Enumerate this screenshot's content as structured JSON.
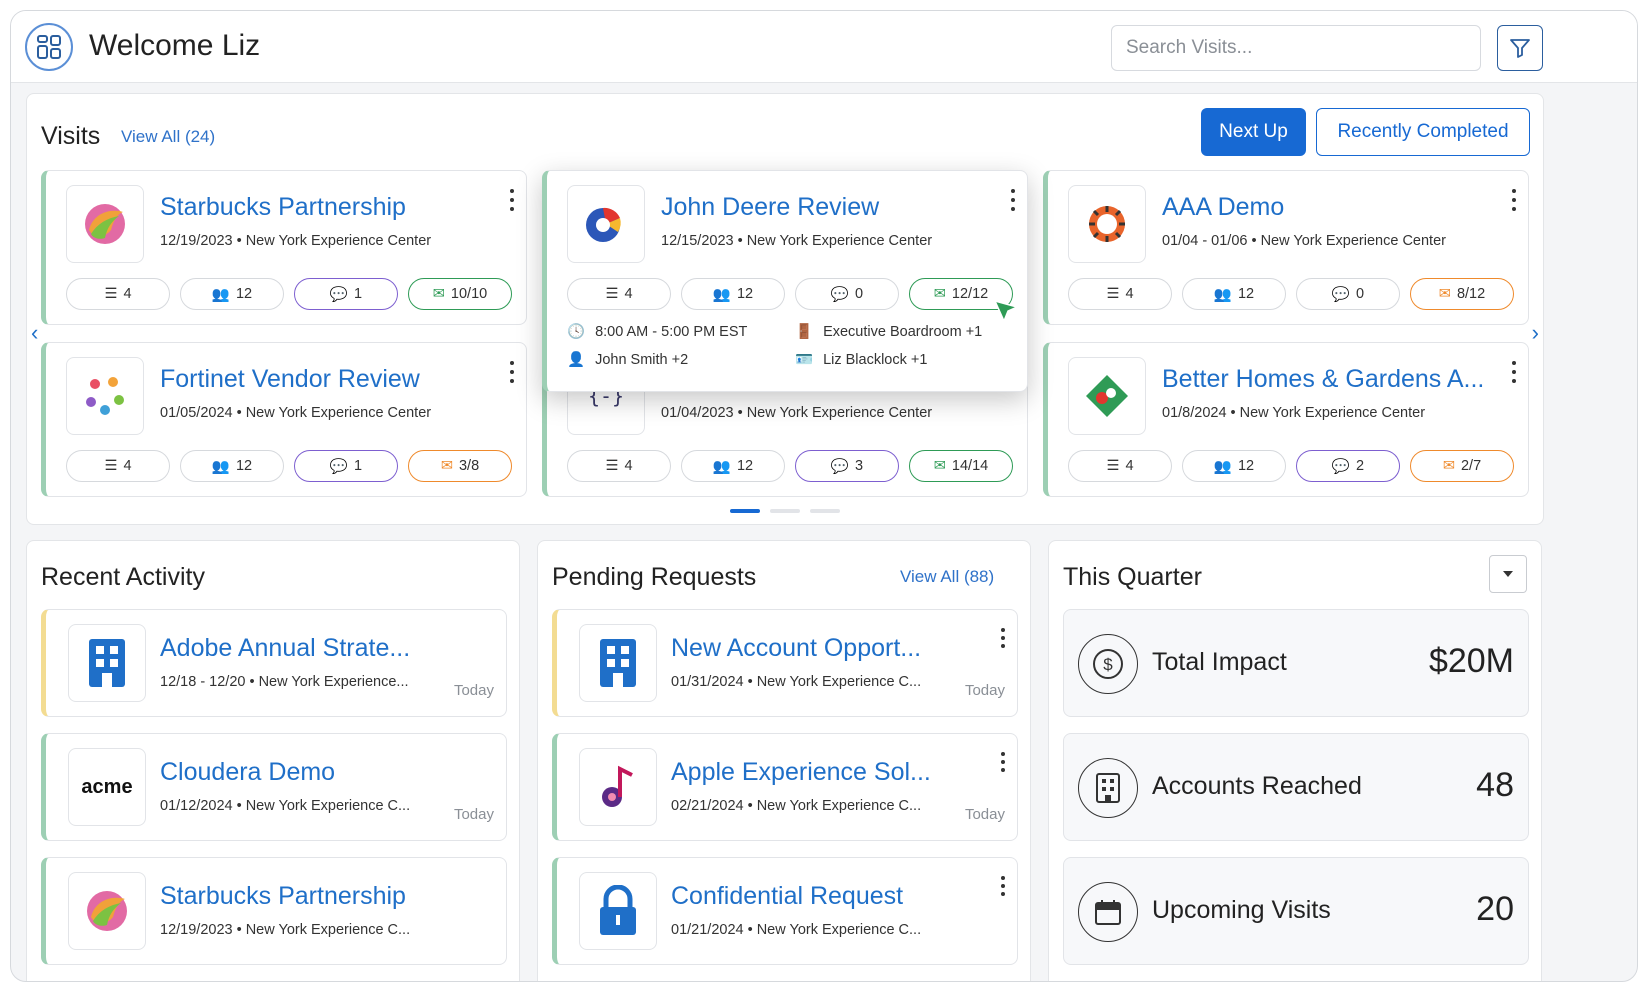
{
  "header": {
    "welcome": "Welcome Liz",
    "search_placeholder": "Search Visits..."
  },
  "visits": {
    "title": "Visits",
    "view_all": "View All (24)",
    "tabs": {
      "next_up": "Next Up",
      "recently_completed": "Recently Completed"
    },
    "cards": [
      {
        "title": "Starbucks Partnership",
        "meta": "12/19/2023 • New York Experience Center",
        "agenda": "4",
        "attendees": "12",
        "comments": "1",
        "invites": "10/10",
        "logo": "starbucks-logo"
      },
      {
        "title": "John Deere Review",
        "meta": "12/15/2023 • New York Experience Center",
        "agenda": "4",
        "attendees": "12",
        "comments": "0",
        "invites": "12/12",
        "logo": "john-deere-logo",
        "details": {
          "time": "8:00 AM - 5:00 PM EST",
          "room": "Executive Boardroom +1",
          "host": "John Smith +2",
          "owner": "Liz Blacklock +1"
        }
      },
      {
        "title": "AAA Demo",
        "meta": "01/04 - 01/06 • New York Experience Center",
        "agenda": "4",
        "attendees": "12",
        "comments": "0",
        "invites": "8/12",
        "logo": "aaa-logo"
      },
      {
        "title": "Fortinet Vendor Review",
        "meta": "01/05/2024 • New York Experience Center",
        "agenda": "4",
        "attendees": "12",
        "comments": "1",
        "invites": "3/8",
        "logo": "fortinet-logo"
      },
      {
        "title": "",
        "meta": "01/04/2023 • New York Experience Center",
        "agenda": "4",
        "attendees": "12",
        "comments": "3",
        "invites": "14/14",
        "logo": "code-logo"
      },
      {
        "title": "Better Homes & Gardens A...",
        "meta": "01/8/2024 • New York Experience Center",
        "agenda": "4",
        "attendees": "12",
        "comments": "2",
        "invites": "2/7",
        "logo": "better-homes-logo"
      }
    ]
  },
  "recent_activity": {
    "title": "Recent Activity",
    "items": [
      {
        "title": "Adobe Annual Strate...",
        "meta": "12/18 - 12/20 • New York Experience...",
        "time": "Today"
      },
      {
        "title": "Cloudera Demo",
        "meta": "01/12/2024 • New York Experience C...",
        "time": "Today",
        "logo_text": "acme"
      },
      {
        "title": "Starbucks Partnership",
        "meta": "12/19/2023 • New York Experience C...",
        "time": ""
      }
    ]
  },
  "pending_requests": {
    "title": "Pending Requests",
    "view_all": "View All (88)",
    "items": [
      {
        "title": "New Account Opport...",
        "meta": "01/31/2024 • New York Experience C...",
        "time": "Today"
      },
      {
        "title": "Apple Experience Sol...",
        "meta": "02/21/2024 • New York Experience C...",
        "time": "Today"
      },
      {
        "title": "Confidential Request",
        "meta": "01/21/2024 • New York Experience C...",
        "time": ""
      }
    ]
  },
  "this_quarter": {
    "title": "This Quarter",
    "stats": [
      {
        "label": "Total Impact",
        "value": "$20M",
        "icon": "dollar-icon"
      },
      {
        "label": "Accounts Reached",
        "value": "48",
        "icon": "building-icon"
      },
      {
        "label": "Upcoming Visits",
        "value": "20",
        "icon": "calendar-icon"
      }
    ]
  },
  "colors": {
    "accent": "#1769d3",
    "title_blue": "#1f6fc8",
    "green": "#2e9b56",
    "purple": "#7d5fd0",
    "orange": "#ef8a2c"
  }
}
